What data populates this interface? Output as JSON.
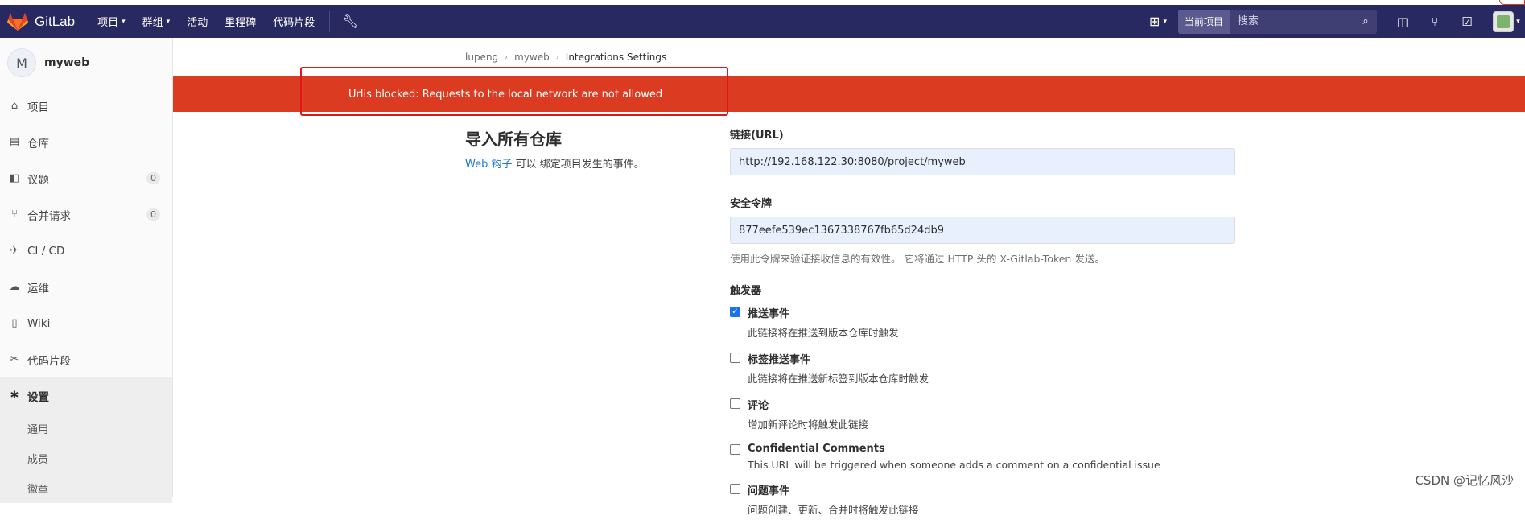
{
  "topbar": {
    "brand": "GitLab",
    "nav": [
      {
        "label": "项目",
        "caret": true
      },
      {
        "label": "群组",
        "caret": true
      },
      {
        "label": "活动",
        "caret": false
      },
      {
        "label": "里程碑",
        "caret": false
      },
      {
        "label": "代码片段",
        "caret": false
      }
    ],
    "search_scope": "当前项目",
    "search_placeholder": "搜索",
    "bg_color": "#292961"
  },
  "sidebar": {
    "project_initial": "M",
    "project_name": "myweb",
    "items": [
      {
        "label": "项目",
        "icon": "home-icon",
        "glyph": "⌂"
      },
      {
        "label": "仓库",
        "icon": "doc-icon",
        "glyph": "▤"
      },
      {
        "label": "议题",
        "icon": "issues-icon",
        "glyph": "◧",
        "count": "0"
      },
      {
        "label": "合并请求",
        "icon": "merge-request-icon",
        "glyph": "⑂",
        "count": "0"
      },
      {
        "label": "CI / CD",
        "icon": "rocket-icon",
        "glyph": "✈"
      },
      {
        "label": "运维",
        "icon": "cloud-gear-icon",
        "glyph": "☁"
      },
      {
        "label": "Wiki",
        "icon": "book-icon",
        "glyph": "▯"
      },
      {
        "label": "代码片段",
        "icon": "scissors-icon",
        "glyph": "✂"
      }
    ],
    "settings": {
      "label": "设置",
      "icon": "gear-icon",
      "glyph": "✱"
    },
    "sub_items": [
      "通用",
      "成员",
      "徽章"
    ]
  },
  "breadcrumb": [
    "lupeng",
    "myweb",
    "Integrations Settings"
  ],
  "alert": {
    "text": "Urlis blocked: Requests to the local network are not allowed",
    "color": "#db3b21"
  },
  "page": {
    "title": "导入所有仓库",
    "desc_link": "Web 钩子",
    "desc_rest": " 可以 绑定项目发生的事件。"
  },
  "form": {
    "url_label": "链接(URL)",
    "url_value": "http://192.168.122.30:8080/project/myweb",
    "token_label": "安全令牌",
    "token_value": "877eefe539ec1367338767fb65d24db9",
    "token_help": "使用此令牌来验证接收信息的有效性。 它将通过 HTTP 头的 X-Gitlab-Token 发送。",
    "triggers_label": "触发器",
    "triggers": [
      {
        "title": "推送事件",
        "desc": "此链接将在推送到版本仓库时触发",
        "checked": true
      },
      {
        "title": "标签推送事件",
        "desc": "此链接将在推送新标签到版本仓库时触发",
        "checked": false
      },
      {
        "title": "评论",
        "desc": "增加新评论时将触发此链接",
        "checked": false
      },
      {
        "title": "Confidential Comments",
        "desc": "This URL will be triggered when someone adds a comment on a confidential issue",
        "checked": false
      },
      {
        "title": "问题事件",
        "desc": "问题创建、更新、合并时将触发此链接",
        "checked": false
      }
    ]
  },
  "watermark": "CSDN @记忆风沙"
}
